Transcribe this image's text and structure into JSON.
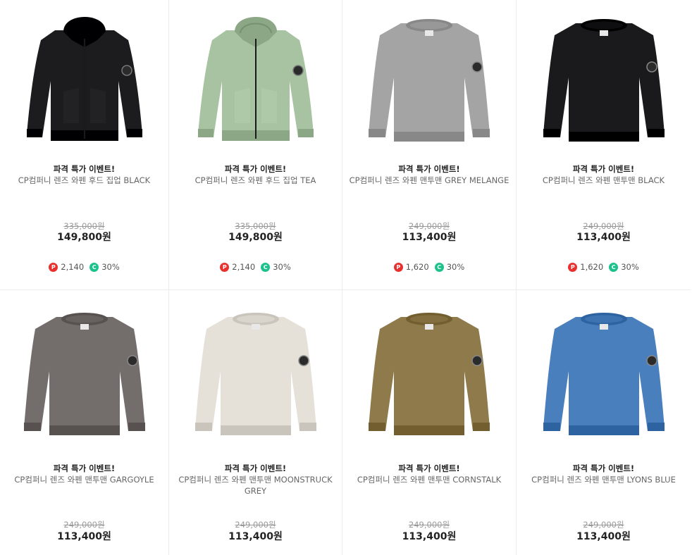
{
  "products": [
    {
      "promo": "파격 특가 이벤트!",
      "name": "CP컴퍼니 렌즈 와펜 후드 집업 BLACK",
      "original_price": "335,000원",
      "sale_price": "149,800원",
      "points": "2,140",
      "coupon": "30%",
      "color": "#1c1c1f",
      "type": "hoodie",
      "icon": "hoodie-icon"
    },
    {
      "promo": "파격 특가 이벤트!",
      "name": "CP컴퍼니 렌즈 와펜 후드 집업 TEA",
      "original_price": "335,000원",
      "sale_price": "149,800원",
      "points": "2,140",
      "coupon": "30%",
      "color": "#a7c3a1",
      "type": "hoodie",
      "icon": "hoodie-icon"
    },
    {
      "promo": "파격 특가 이벤트!",
      "name": "CP컴퍼니 렌즈 와펜 맨투맨 GREY MELANGE",
      "original_price": "249,000원",
      "sale_price": "113,400원",
      "points": "1,620",
      "coupon": "30%",
      "color": "#a4a4a4",
      "type": "crew",
      "icon": "sweatshirt-icon"
    },
    {
      "promo": "파격 특가 이벤트!",
      "name": "CP컴퍼니 렌즈 와펜 맨투맨 BLACK",
      "original_price": "249,000원",
      "sale_price": "113,400원",
      "points": "1,620",
      "coupon": "30%",
      "color": "#1a1a1c",
      "type": "crew",
      "icon": "sweatshirt-icon"
    },
    {
      "promo": "파격 특가 이벤트!",
      "name": "CP컴퍼니 렌즈 와펜 맨투맨 GARGOYLE",
      "original_price": "249,000원",
      "sale_price": "113,400원",
      "color": "#736d6b",
      "type": "crew",
      "icon": "sweatshirt-icon"
    },
    {
      "promo": "파격 특가 이벤트!",
      "name": "CP컴퍼니 렌즈 와펜 맨투맨 MOONSTRUCK GREY",
      "original_price": "249,000원",
      "sale_price": "113,400원",
      "color": "#e5e1d8",
      "type": "crew",
      "icon": "sweatshirt-icon"
    },
    {
      "promo": "파격 특가 이벤트!",
      "name": "CP컴퍼니 렌즈 와펜 맨투맨 CORNSTALK",
      "original_price": "249,000원",
      "sale_price": "113,400원",
      "color": "#8f7a4b",
      "type": "crew",
      "icon": "sweatshirt-icon"
    },
    {
      "promo": "파격 특가 이벤트!",
      "name": "CP컴퍼니 렌즈 와펜 맨투맨 LYONS BLUE",
      "original_price": "249,000원",
      "sale_price": "113,400원",
      "color": "#4a7fbe",
      "type": "crew",
      "icon": "sweatshirt-icon"
    }
  ]
}
